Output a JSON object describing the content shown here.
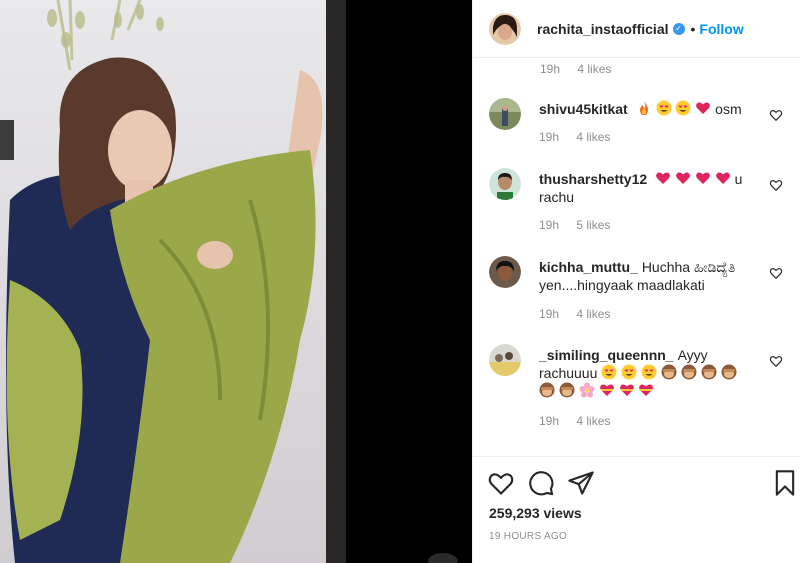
{
  "header": {
    "username": "rachita_instaofficial",
    "verified_icon": "verified-badge-icon",
    "separator": "•",
    "follow_label": "Follow"
  },
  "partial_comment": {
    "time": "19h",
    "likes": "4 likes"
  },
  "comments": [
    {
      "username": "shivu45kitkat",
      "emojis": [
        "fire",
        "heart-eyes",
        "heart-eyes",
        "red-heart"
      ],
      "text": " osm",
      "time": "19h",
      "likes": "4 likes"
    },
    {
      "username": "thusharshetty12",
      "emojis": [
        "red-heart",
        "red-heart",
        "red-heart",
        "red-heart"
      ],
      "text": "u rachu",
      "time": "19h",
      "likes": "5 likes"
    },
    {
      "username": "kichha_muttu_",
      "text": "Huchha ಹೀಡಿದ್ಯೆತಿ yen....hingyaak maadlakati",
      "time": "19h",
      "likes": "4 likes"
    },
    {
      "username": "_similing_queennn_",
      "text": "Ayyy rachuuuu",
      "emojis": [
        "heart-eyes",
        "heart-eyes",
        "heart-eyes",
        "see-no-evil-monkey",
        "see-no-evil-monkey",
        "see-no-evil-monkey",
        "see-no-evil-monkey",
        "see-no-evil-monkey",
        "see-no-evil-monkey",
        "cherry-blossom",
        "heart-ribbon",
        "heart-ribbon",
        "heart-ribbon"
      ],
      "time": "19h",
      "likes": "4 likes"
    }
  ],
  "actions": {
    "like_icon": "heart-icon",
    "comment_icon": "comment-icon",
    "share_icon": "share-icon",
    "save_icon": "bookmark-icon"
  },
  "views": "259,293 views",
  "posted": "19 HOURS AGO",
  "colors": {
    "accent": "#0095f6",
    "verified": "#3897f0",
    "heart": "#e0245e",
    "dupatta": "#9aa84a",
    "kurta": "#1f2a55"
  }
}
